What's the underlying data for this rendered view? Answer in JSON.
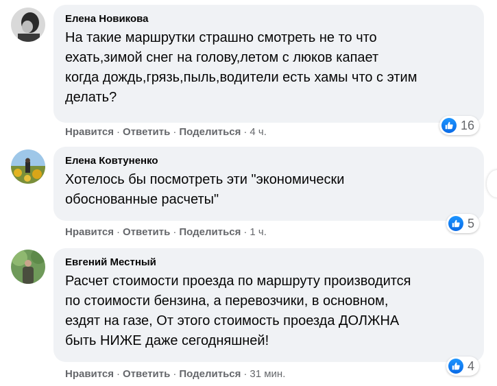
{
  "comments": [
    {
      "author": "Елена Новикова",
      "text": "На такие маршрутки страшно смотреть не то что\nехать,зимой снег на голову,летом с люков капает\nкогда дождь,грязь,пыль,водители есть хамы что с этим\nделать?",
      "actions": {
        "like": "Нравится",
        "reply": "Ответить",
        "share": "Поделиться",
        "time": "4 ч."
      },
      "reaction_count": "16"
    },
    {
      "author": "Елена Ковтуненко",
      "text": "Хотелось бы посмотреть эти \"экономически\nобоснованные расчеты\"",
      "actions": {
        "like": "Нравится",
        "reply": "Ответить",
        "share": "Поделиться",
        "time": "1 ч."
      },
      "reaction_count": "5"
    },
    {
      "author": "Евгений Местный",
      "text": "Расчет стоимости проезда по маршруту производится\nпо стоимости бензина, а перевозчики, в основном,\nездят на газе, От этого стоимость проезда ДОЛЖНА\nбыть НИЖЕ даже сегодняшней!",
      "actions": {
        "like": "Нравится",
        "reply": "Ответить",
        "share": "Поделиться",
        "time": "31 мин."
      },
      "reaction_count": "4"
    }
  ],
  "separator": "·",
  "icons": {
    "reaction": "like-icon"
  },
  "colors": {
    "bubble": "#f0f2f5",
    "meta_text": "#65676b",
    "like_blue": "#1877f2"
  }
}
